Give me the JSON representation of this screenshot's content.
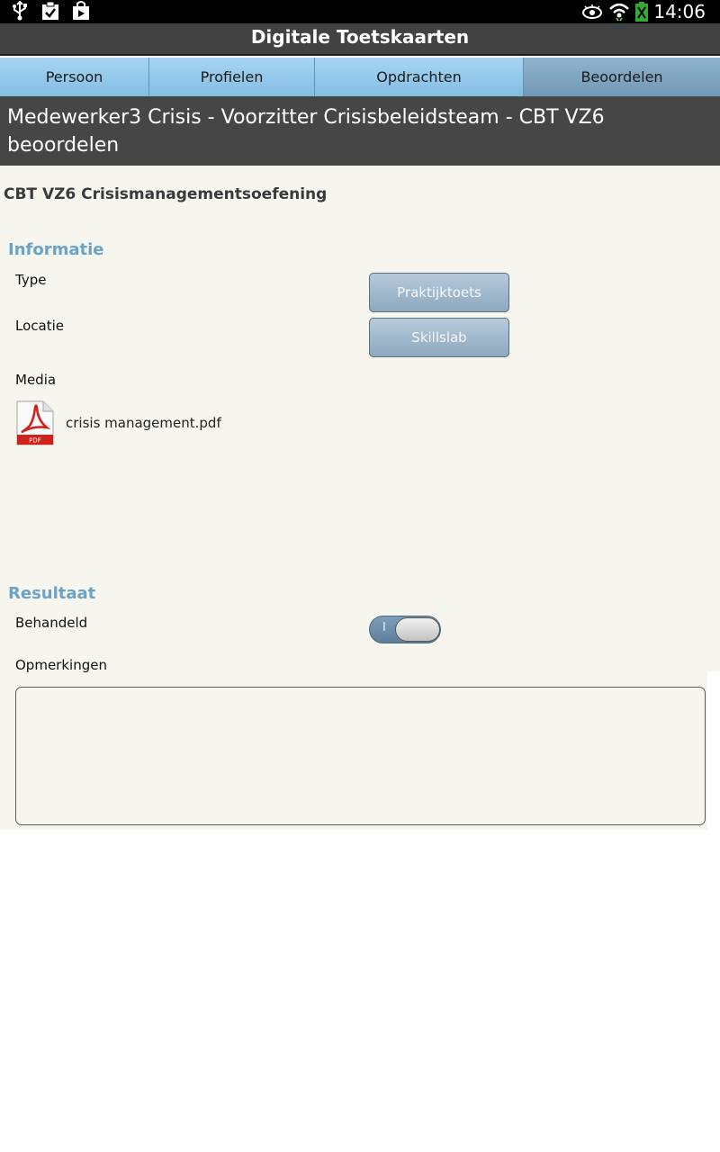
{
  "status_bar": {
    "time": "14:06",
    "icons": [
      "usb-icon",
      "clipboard-check-icon",
      "shopping-bag-icon",
      "eye-icon",
      "wifi-icon",
      "battery-icon"
    ]
  },
  "app": {
    "title": "Digitale Toetskaarten"
  },
  "tabs": [
    {
      "label": "Persoon"
    },
    {
      "label": "Profielen"
    },
    {
      "label": "Opdrachten"
    },
    {
      "label": "Beoordelen",
      "active": true
    }
  ],
  "page_header": {
    "title": "Medewerker3 Crisis - Voorzitter Crisisbeleidsteam - CBT VZ6 beoordelen"
  },
  "exam": {
    "title": "CBT VZ6 Crisismanagementsoefening"
  },
  "information": {
    "heading": "Informatie",
    "type_label": "Type",
    "type_value": "Praktijktoets",
    "location_label": "Locatie",
    "location_value": "Skillslab",
    "media_label": "Media",
    "media_file": "crisis management.pdf",
    "media_badge": "PDF"
  },
  "result": {
    "heading": "Resultaat",
    "handled_label": "Behandeld",
    "handled_toggle_mark": "I",
    "handled_value": false,
    "remarks_label": "Opmerkingen",
    "remarks_value": ""
  },
  "colors": {
    "section_heading": "#6aa3c8",
    "tab_bar": "#8cc3e6",
    "header_bg": "#464646",
    "content_bg": "#f6f5ee"
  }
}
